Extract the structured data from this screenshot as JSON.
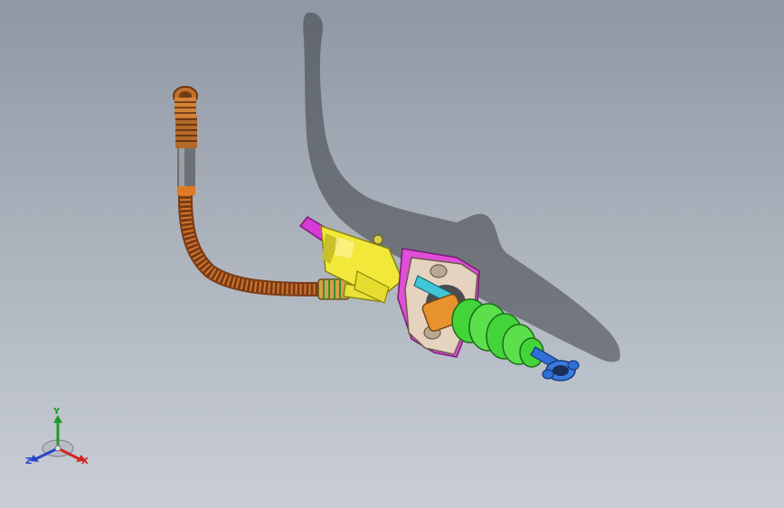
{
  "viewport": {
    "model_icon": "clutch-master-cylinder-assembly-icon",
    "background_top": "#8f97a4",
    "background_bottom": "#c9ced6"
  },
  "triad": {
    "x_label": "X",
    "y_label": "Y",
    "z_label": "Z",
    "x_color": "#d2231f",
    "y_color": "#1f9a2a",
    "z_color": "#2a43c8"
  }
}
